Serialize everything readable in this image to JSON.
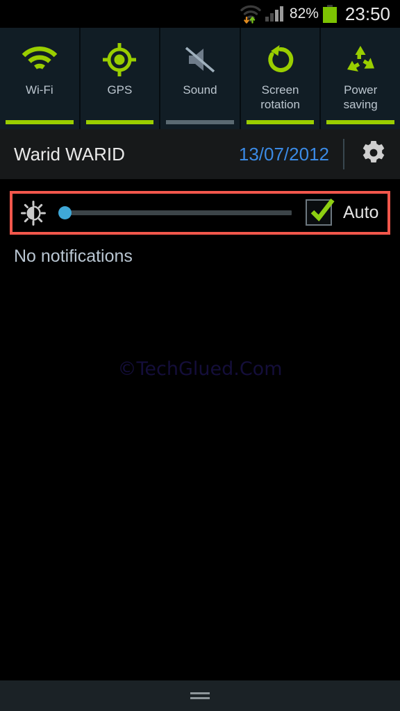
{
  "status_bar": {
    "wifi_icon": "wifi-no-internet-icon",
    "data_transfer_icon": "data-updown-arrows-icon",
    "signal_icon": "cellular-signal-icon",
    "signal_bars_total": 4,
    "signal_bars_active": 2,
    "battery_percent_label": "82%",
    "battery_icon": "battery-full-icon",
    "clock": "23:50"
  },
  "quick_toggles": [
    {
      "label": "Wi-Fi",
      "icon": "wifi-icon",
      "state": "on"
    },
    {
      "label": "GPS",
      "icon": "gps-crosshair-icon",
      "state": "on"
    },
    {
      "label": "Sound",
      "icon": "sound-muted-icon",
      "state": "off"
    },
    {
      "label": "Screen\nrotation",
      "label_line1": "Screen",
      "label_line2": "rotation",
      "icon": "rotate-icon",
      "state": "on"
    },
    {
      "label": "Power\nsaving",
      "label_line1": "Power",
      "label_line2": "saving",
      "icon": "recycle-icon",
      "state": "on"
    }
  ],
  "carrier_row": {
    "carrier_name": "Warid WARID",
    "date": "13/07/2012",
    "settings_icon": "gear-icon"
  },
  "brightness_row": {
    "brightness_icon": "brightness-sun-icon",
    "slider_value_percent": 0,
    "slider_thumb_color": "#3fa8d8",
    "slider_track_color": "#3c4448",
    "auto_label": "Auto",
    "auto_checked": true,
    "checkbox_icon": "checkbox-checked-icon",
    "highlight_color": "#f2574c"
  },
  "notifications": {
    "empty_text": "No notifications"
  },
  "watermark": {
    "text": "©TechGlued.Com"
  },
  "bottom_bar": {
    "handle_icon": "drag-handle-icon"
  },
  "colors": {
    "accent_green": "#9ace00",
    "date_blue": "#3b8ae5",
    "panel_bg": "#111d25",
    "carrier_bg": "#17191a",
    "label_gray": "#bcc6cf"
  }
}
